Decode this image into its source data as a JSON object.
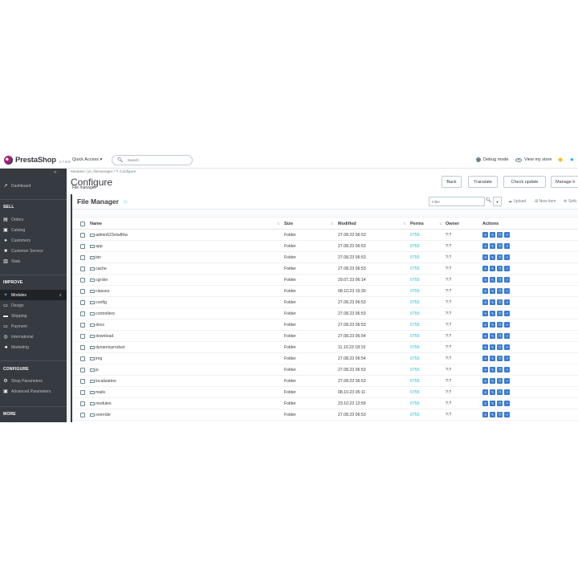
{
  "header": {
    "brand": "PrestaShop",
    "version": "1.7.8.9",
    "quick_access": "Quick Access ▾",
    "search_placeholder": "Search",
    "debug_mode": "Debug mode",
    "view_store": "View my store"
  },
  "sidebar": {
    "dashboard": "Dashboard",
    "sections": {
      "sell": "SELL",
      "improve": "IMPROVE",
      "configure": "CONFIGURE",
      "more": "MORE"
    },
    "sell_items": [
      "Orders",
      "Catalog",
      "Customers",
      "Customer Service",
      "Stats"
    ],
    "improve_items": [
      "Modules",
      "Design",
      "Shipping",
      "Payment",
      "International",
      "Marketing"
    ],
    "configure_items": [
      "Shop Parameters",
      "Advanced Parameters"
    ]
  },
  "page": {
    "breadcrumb": "Modules  /  jxt_filemanager  /  ✎ Configure",
    "title": "Configure",
    "subtitle": "File manager",
    "buttons": [
      "Back",
      "Translate",
      "Check update",
      "Manage h"
    ]
  },
  "panel": {
    "title": "File Manager",
    "filter_placeholder": "Filter",
    "upload": "Upload",
    "new_item": "New item",
    "settings": "Setti"
  },
  "table": {
    "columns": [
      "Name",
      "Size",
      "Modified",
      "Perms",
      "Owner",
      "Actions"
    ],
    "rows": [
      {
        "name": "admin623vtw8hw",
        "size": "Folder",
        "modified": "27.08.23 06:53",
        "perms": "0755",
        "owner": "?:?"
      },
      {
        "name": "app",
        "size": "Folder",
        "modified": "27.08.23 06:53",
        "perms": "0755",
        "owner": "?:?"
      },
      {
        "name": "bin",
        "size": "Folder",
        "modified": "27.08.23 06:53",
        "perms": "0755",
        "owner": "?:?"
      },
      {
        "name": "cache",
        "size": "Folder",
        "modified": "27.08.23 06:53",
        "perms": "0755",
        "owner": "?:?"
      },
      {
        "name": "cgi-bin",
        "size": "Folder",
        "modified": "29.07.23 06:14",
        "perms": "0755",
        "owner": "?:?"
      },
      {
        "name": "classes",
        "size": "Folder",
        "modified": "08.10.23 15:30",
        "perms": "0755",
        "owner": "?:?"
      },
      {
        "name": "config",
        "size": "Folder",
        "modified": "27.08.23 06:53",
        "perms": "0755",
        "owner": "?:?"
      },
      {
        "name": "controllers",
        "size": "Folder",
        "modified": "27.08.23 06:53",
        "perms": "0755",
        "owner": "?:?"
      },
      {
        "name": "docs",
        "size": "Folder",
        "modified": "27.08.23 06:53",
        "perms": "0755",
        "owner": "?:?"
      },
      {
        "name": "download",
        "size": "Folder",
        "modified": "27.08.23 06:54",
        "perms": "0755",
        "owner": "?:?"
      },
      {
        "name": "dynamicproduct",
        "size": "Folder",
        "modified": "11.10.23 18:15",
        "perms": "0755",
        "owner": "?:?"
      },
      {
        "name": "img",
        "size": "Folder",
        "modified": "27.08.23 06:54",
        "perms": "0755",
        "owner": "?:?"
      },
      {
        "name": "js",
        "size": "Folder",
        "modified": "27.08.23 06:53",
        "perms": "0755",
        "owner": "?:?"
      },
      {
        "name": "localization",
        "size": "Folder",
        "modified": "27.08.23 06:53",
        "perms": "0755",
        "owner": "?:?"
      },
      {
        "name": "mails",
        "size": "Folder",
        "modified": "08.10.23 05:11",
        "perms": "0755",
        "owner": "?:?"
      },
      {
        "name": "modules",
        "size": "Folder",
        "modified": "23.10.23 12:59",
        "perms": "0755",
        "owner": "?:?"
      },
      {
        "name": "override",
        "size": "Folder",
        "modified": "27.08.23 06:53",
        "perms": "0755",
        "owner": "?:?"
      }
    ]
  },
  "colors": {
    "sidebar": "#363a41",
    "accent": "#25b9d7",
    "action": "#3a7bd5"
  }
}
